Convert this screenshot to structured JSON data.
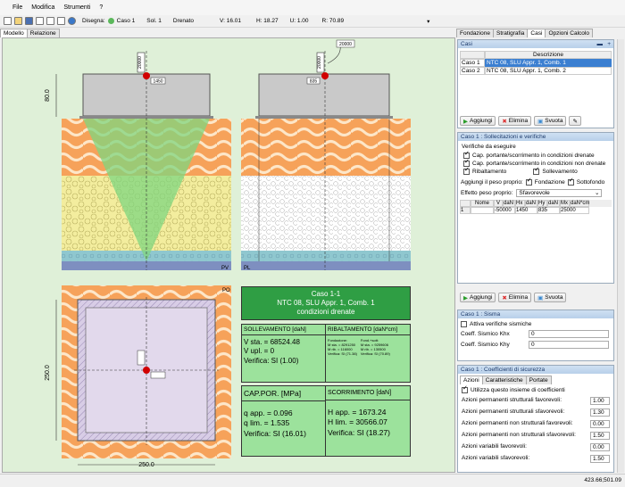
{
  "menu": [
    "File",
    "Modifica",
    "Strumenti",
    "?"
  ],
  "toolbar": {
    "disegna_label": "Disegna:",
    "caso": "Caso 1",
    "sol": "Sol. 1",
    "drenato": "Drenato",
    "v": "V: 16.01",
    "h": "H: 18.27",
    "u": "U: 1.00",
    "r": "R: 70.89"
  },
  "left_tabs": [
    "Modello",
    "Relazione"
  ],
  "right_tabs": [
    "Fondazione",
    "Stratigrafia",
    "Casi",
    "Opzioni Calcolo"
  ],
  "drawing": {
    "left_load": "20000",
    "right_load": "20000",
    "right_load2": "20000",
    "dim_left": "80.0",
    "w_label": "1450",
    "w_label2": "835",
    "pv": "PV",
    "pl": "PL",
    "po": "PO",
    "h_label": "250.0",
    "w_bottom": "250.0"
  },
  "result": {
    "caso_title": "Caso 1-1",
    "norm": "NTC 08, SLU Appr. 1, Comb. 1",
    "cond": "condizioni drenate",
    "soll_h": "SOLLEVAMENTO [daN]",
    "rib_h": "RIBALTAMENTO [daN*cm]",
    "v_sta": "V sta. = 68524.48",
    "v_upl": "V upl. = 0",
    "soll_ver": "Verifica: SI (1.00)",
    "rib_fond_t": "Fondazione:",
    "rib_fond_1": "M sta. = 8291250",
    "rib_fond_2": "M rib. = 116000",
    "rib_fond_3": "Verifica: SI (71.38)",
    "rib_eccl_t": "Fond.+sott:",
    "rib_eccl_1": "M sta. = 9259606",
    "rib_eccl_2": "M rib. = 130500",
    "rib_eccl_3": "Verifica: SI (70.89)",
    "cap_h": "CAP.POR. [MPa]",
    "scorr_h": "SCORRIMENTO [daN]",
    "q_app": "q app. = 0.096",
    "q_lim": "q lim. = 1.535",
    "cap_ver": "Verifica: SI (16.01)",
    "h_app": "H app. = 1673.24",
    "h_lim": "H lim. = 30566.07",
    "scorr_ver": "Verifica: SI (18.27)"
  },
  "casi": {
    "title": "Casi",
    "col": "Descrizione",
    "rows": [
      {
        "k": "Caso 1",
        "d": "NTC 08, SLU Appr. 1, Comb. 1"
      },
      {
        "k": "Caso 2",
        "d": "NTC 08, SLU Appr. 1, Comb. 2"
      }
    ],
    "aggiungi": "Aggiungi",
    "elimina": "Elimina",
    "svuota": "Svuota"
  },
  "soll": {
    "title": "Caso 1 : Sollecitazioni e verifiche",
    "ver_title": "Verifiche da eseguire",
    "c1": "Cap. portante/scorrimento in condizioni drenate",
    "c2": "Cap. portante/scorrimento in condizioni non drenate",
    "c3": "Ribaltamento",
    "c4": "Sollevamento",
    "peso_label": "Aggiungi il peso proprio:",
    "fond": "Fondazione",
    "sott": "Sottofondo",
    "eff_label": "Effetto peso proprio:",
    "eff_val": "Sfavorevole",
    "cols": [
      "Nome",
      "V",
      "daN",
      "Hx",
      "daN",
      "Hy",
      "daN",
      "Mx",
      "daN*cm"
    ],
    "row": [
      "1",
      "",
      "-50000",
      "1450",
      "835",
      "25000"
    ]
  },
  "sisma": {
    "title": "Caso 1 : Sisma",
    "attiva": "Attiva verifiche sismiche",
    "khx_label": "Coeff. Sismico Khx",
    "khx": "0",
    "khy_label": "Coeff. Sismico Khy",
    "khy": "0"
  },
  "coeff": {
    "title": "Caso 1 : Coefficienti di sicurezza",
    "tabs": [
      "Azioni",
      "Caratteristiche",
      "Portate"
    ],
    "use": "Utilizza questo insieme di coefficienti",
    "rows": [
      {
        "l": "Azioni permanenti strutturali favorevoli:",
        "v": "1.00"
      },
      {
        "l": "Azioni permanenti strutturali sfavorevoli:",
        "v": "1.30"
      },
      {
        "l": "Azioni permanenti non strutturali favorevoli:",
        "v": "0.00"
      },
      {
        "l": "Azioni permanenti non strutturali sfavorevoli:",
        "v": "1.50"
      },
      {
        "l": "Azioni variabili favorevoli:",
        "v": "0.00"
      },
      {
        "l": "Azioni variabili sfavorevoli:",
        "v": "1.50"
      }
    ]
  },
  "status": "423.66;501.09"
}
